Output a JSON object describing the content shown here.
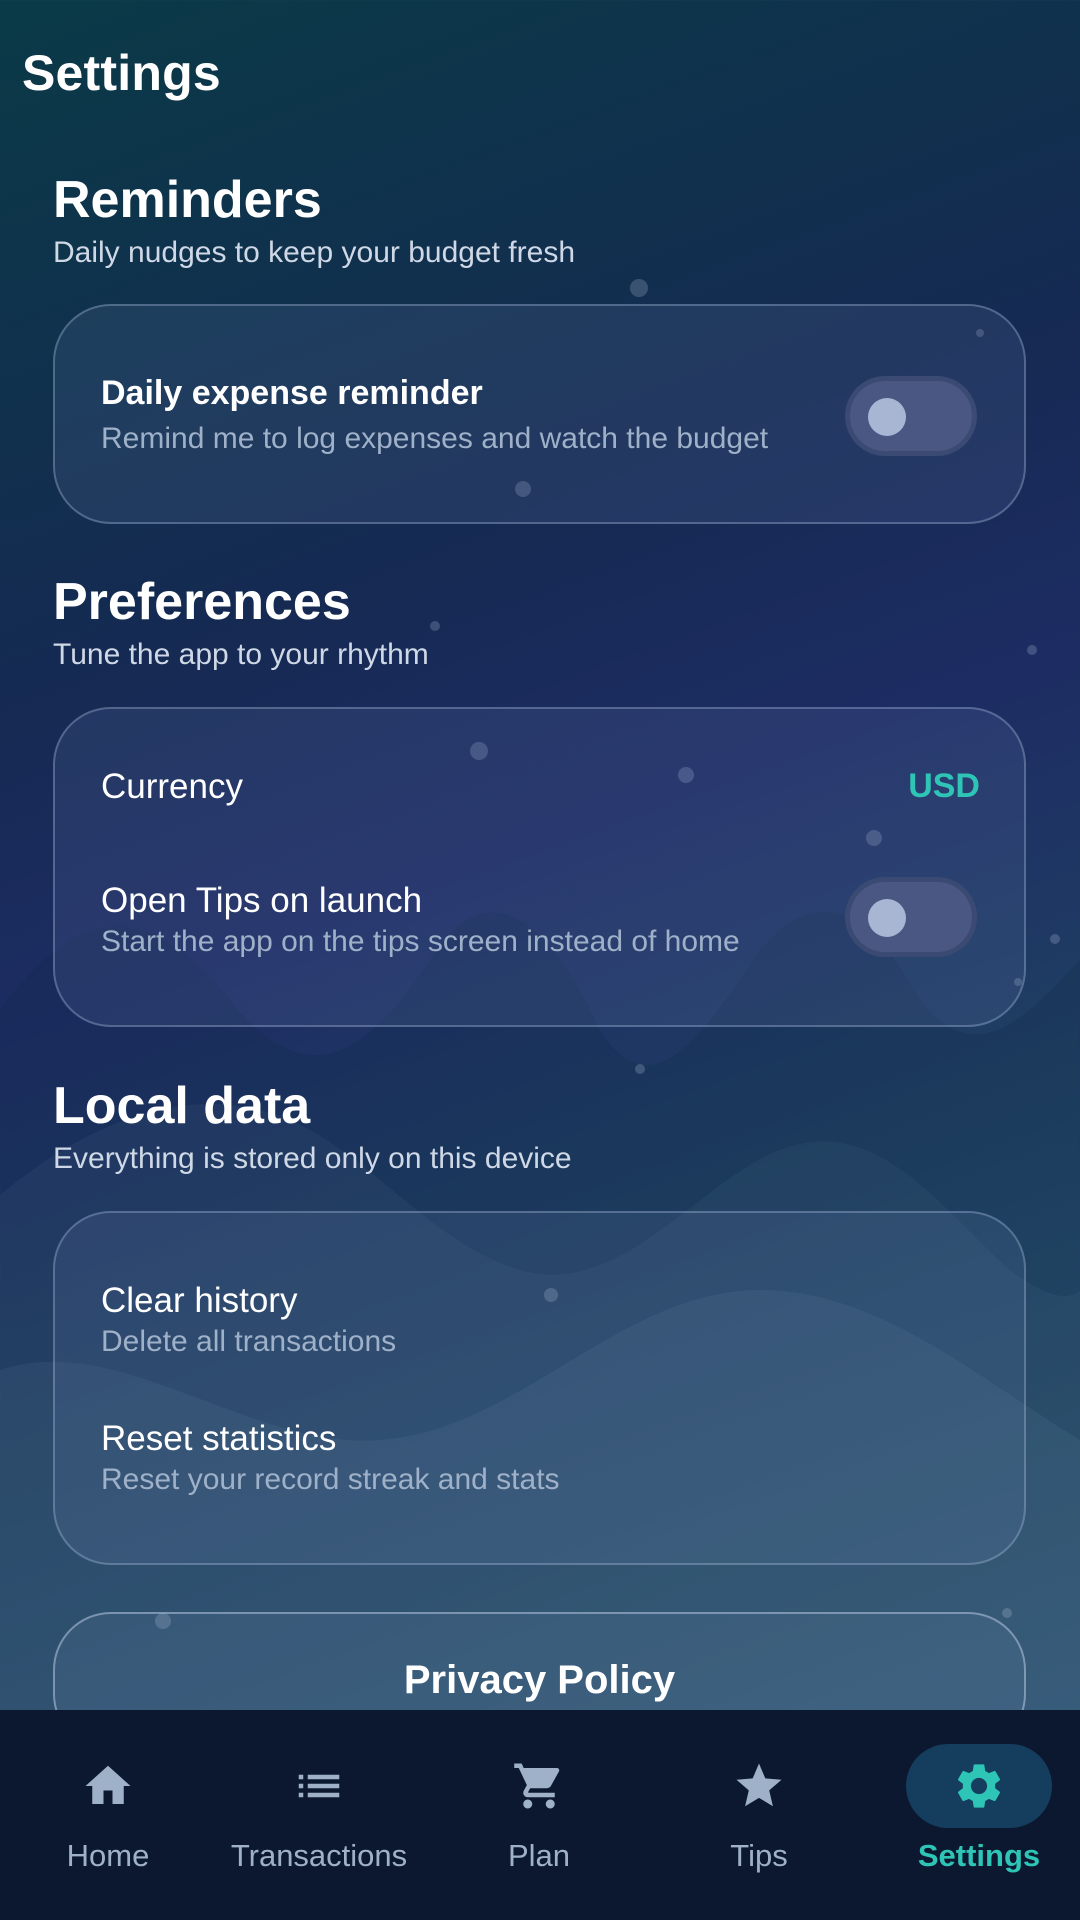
{
  "page": {
    "title": "Settings"
  },
  "colors": {
    "accent": "#2ec4b6",
    "nav_inactive": "#9fb1c8",
    "card_subtext": "#9fb1c8"
  },
  "reminders": {
    "title": "Reminders",
    "subtitle": "Daily nudges to keep your budget fresh",
    "daily": {
      "title": "Daily expense reminder",
      "subtitle": "Remind me to log expenses and watch the budget",
      "enabled": false
    }
  },
  "preferences": {
    "title": "Preferences",
    "subtitle": "Tune the app to your rhythm",
    "currency": {
      "label": "Currency",
      "value": "USD"
    },
    "open_tips": {
      "title": "Open Tips on launch",
      "subtitle": "Start the app on the tips screen instead of home",
      "enabled": false
    }
  },
  "local_data": {
    "title": "Local data",
    "subtitle": "Everything is stored only on this device",
    "clear_history": {
      "title": "Clear history",
      "subtitle": "Delete all transactions"
    },
    "reset_stats": {
      "title": "Reset statistics",
      "subtitle": "Reset your record streak and stats"
    }
  },
  "privacy": {
    "label": "Privacy Policy"
  },
  "nav": {
    "items": [
      {
        "label": "Home",
        "icon": "home-icon"
      },
      {
        "label": "Transactions",
        "icon": "list-icon"
      },
      {
        "label": "Plan",
        "icon": "cart-icon"
      },
      {
        "label": "Tips",
        "icon": "star-icon"
      },
      {
        "label": "Settings",
        "icon": "gear-icon",
        "active": true
      }
    ]
  }
}
